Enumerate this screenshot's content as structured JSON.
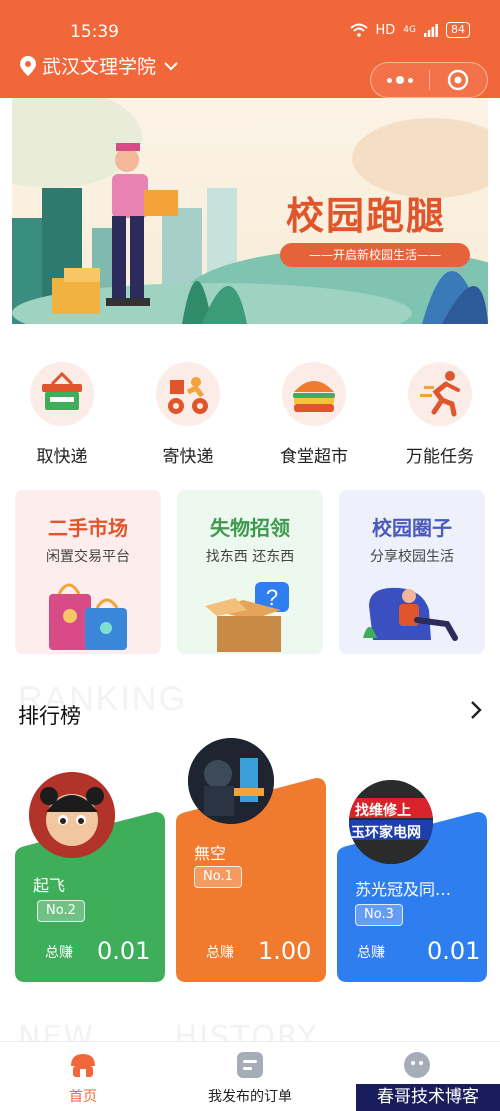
{
  "status_bar": {
    "time": "15:39",
    "network": "HD",
    "signal": "4G",
    "battery": "84"
  },
  "header": {
    "location": "武汉文理学院"
  },
  "banner": {
    "title": "校园跑腿",
    "subtitle": "——开启新校园生活——"
  },
  "quick_services": [
    {
      "label": "取快递",
      "icon": "basket-icon"
    },
    {
      "label": "寄快递",
      "icon": "delivery-bike-icon"
    },
    {
      "label": "食堂超市",
      "icon": "burger-icon"
    },
    {
      "label": "万能任务",
      "icon": "runner-icon"
    }
  ],
  "feature_cards": [
    {
      "title": "二手市场",
      "subtitle": "闲置交易平台",
      "color": "#e0552b"
    },
    {
      "title": "失物招领",
      "subtitle": "找东西 还东西",
      "color": "#3d9a4f"
    },
    {
      "title": "校园圈子",
      "subtitle": "分享校园生活",
      "color": "#4a5ab8"
    }
  ],
  "ranking": {
    "background_text": "RANKING",
    "title": "排行榜",
    "entries": [
      {
        "name": "起飞",
        "rank": "No.2",
        "earn_label": "总赚",
        "earn": "0.01",
        "color": "#3fae5a"
      },
      {
        "name": "無空",
        "rank": "No.1",
        "earn_label": "总赚",
        "earn": "1.00",
        "color": "#f07a2e"
      },
      {
        "name": "苏光冠及同…",
        "rank": "No.3",
        "earn_label": "总赚",
        "earn": "0.01",
        "color": "#2f7ef0",
        "avatar_text_top": "找维修上",
        "avatar_text_bottom": "玉环家电网"
      }
    ]
  },
  "bottom_bg": {
    "left": "NEW",
    "right": "HISTORY"
  },
  "tabbar": {
    "tabs": [
      {
        "label": "首页",
        "icon": "home-icon"
      },
      {
        "label": "我发布的订单",
        "icon": "orders-icon"
      },
      {
        "label": "",
        "icon": "profile-icon"
      }
    ]
  },
  "watermark": "春哥技术博客"
}
